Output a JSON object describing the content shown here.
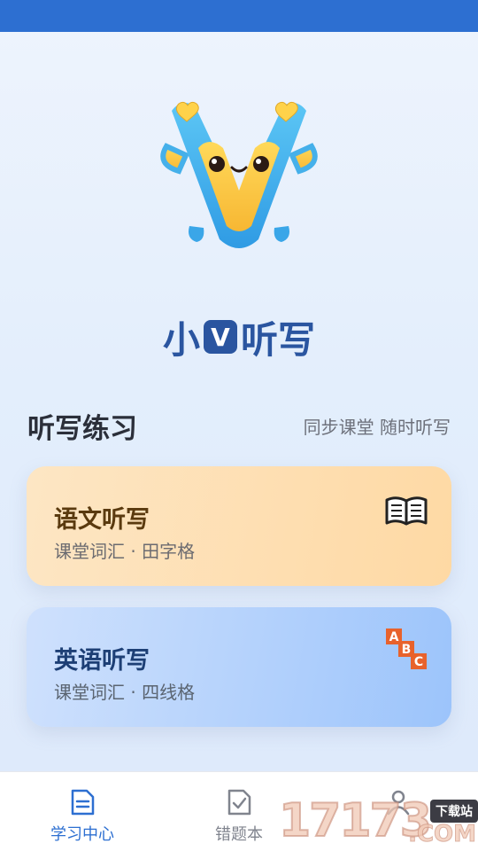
{
  "app": {
    "title_prefix": "小",
    "title_badge": "V",
    "title_suffix": "听写"
  },
  "section": {
    "title": "听写练习",
    "subtitle": "同步课堂 随时听写"
  },
  "cards": [
    {
      "title": "语文听写",
      "subtitle": "课堂词汇 · 田字格",
      "icon": "open-book-icon"
    },
    {
      "title": "英语听写",
      "subtitle": "课堂词汇 · 四线格",
      "icon": "abc-blocks-icon",
      "icon_letters": [
        "A",
        "B",
        "C"
      ]
    }
  ],
  "tabs": [
    {
      "label": "学习中心",
      "icon": "document-icon",
      "active": true
    },
    {
      "label": "错题本",
      "icon": "check-clipboard-icon",
      "active": false
    },
    {
      "label": "",
      "icon": "person-icon",
      "active": false
    }
  ],
  "watermark": {
    "number": "17173",
    "tag": "下载站",
    "suffix": ".COM"
  },
  "colors": {
    "status_bar": "#2d6fd1",
    "brand": "#2a55a0",
    "active_tab": "#2d6fd1",
    "chinese_card": "#fed9a4",
    "english_card": "#9cc4fb"
  }
}
